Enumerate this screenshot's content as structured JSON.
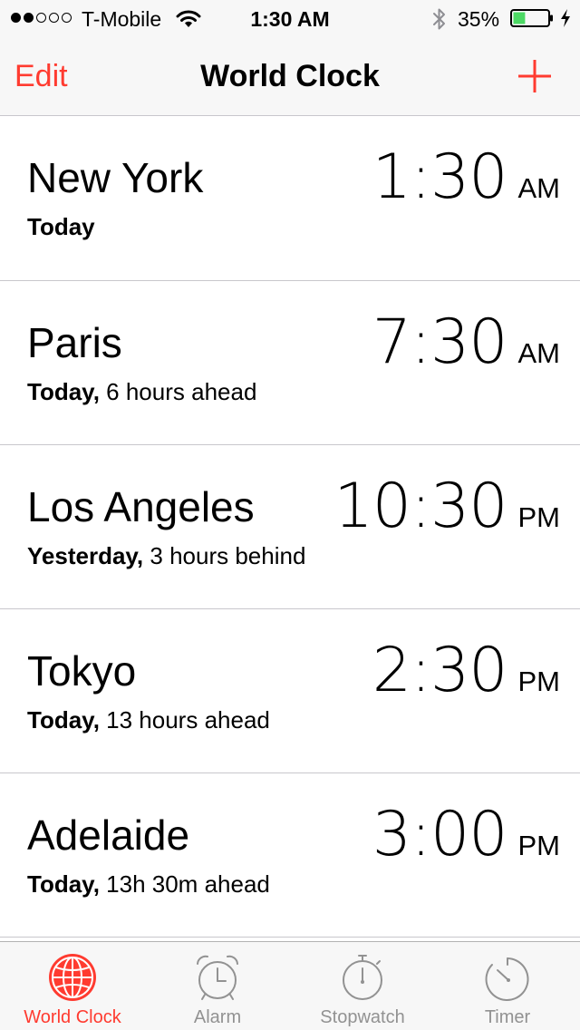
{
  "status_bar": {
    "carrier": "T-Mobile",
    "time": "1:30 AM",
    "battery_percent": "35%",
    "battery_level": 0.35,
    "signal_bars_filled": 2,
    "signal_bars_total": 5
  },
  "nav": {
    "edit_label": "Edit",
    "title": "World Clock",
    "add_icon": "plus-icon"
  },
  "cities": [
    {
      "name": "New York",
      "day": "Today",
      "offset": "",
      "time": "1:30",
      "ampm": "AM"
    },
    {
      "name": "Paris",
      "day": "Today,",
      "offset": " 6 hours ahead",
      "time": "7:30",
      "ampm": "AM"
    },
    {
      "name": "Los Angeles",
      "day": "Yesterday,",
      "offset": " 3 hours behind",
      "time": "10:30",
      "ampm": "PM"
    },
    {
      "name": "Tokyo",
      "day": "Today,",
      "offset": " 13 hours ahead",
      "time": "2:30",
      "ampm": "PM"
    },
    {
      "name": "Adelaide",
      "day": "Today,",
      "offset": " 13h 30m ahead",
      "time": "3:00",
      "ampm": "PM"
    }
  ],
  "tabs": [
    {
      "label": "World Clock",
      "icon": "globe-icon",
      "active": true
    },
    {
      "label": "Alarm",
      "icon": "alarm-clock-icon",
      "active": false
    },
    {
      "label": "Stopwatch",
      "icon": "stopwatch-icon",
      "active": false
    },
    {
      "label": "Timer",
      "icon": "timer-icon",
      "active": false
    }
  ],
  "colors": {
    "accent": "#ff3b30",
    "inactive_tab": "#929292",
    "separator": "#c8c7cc",
    "bar_background": "#f7f7f7",
    "battery_fill": "#4cd964"
  }
}
